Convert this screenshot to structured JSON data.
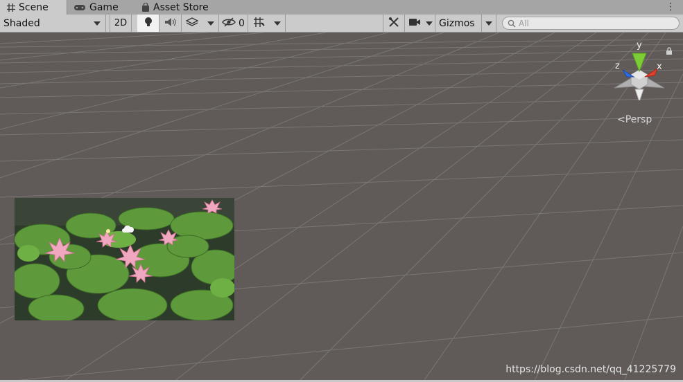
{
  "tabs": [
    {
      "label": "Scene",
      "icon": "hash-grid-icon",
      "active": true
    },
    {
      "label": "Game",
      "icon": "gamepad-icon",
      "active": false
    },
    {
      "label": "Asset Store",
      "icon": "shopping-bag-icon",
      "active": false
    }
  ],
  "toolbar": {
    "draw_mode": "Shaded",
    "mode_2d_label": "2D",
    "hidden_count": "0",
    "gizmos_label": "Gizmos",
    "search_placeholder": "All"
  },
  "viewport": {
    "background_color": "#605b58",
    "grid_color": "#7a7673",
    "projection_label": "Persp",
    "axis_labels": {
      "y": "y",
      "x": "x",
      "z": "z"
    },
    "axis_colors": {
      "y": "#7ccc36",
      "x": "#e0402c",
      "z": "#2f6ee8"
    },
    "image_description_name": "water-lily-quad"
  },
  "watermark": "https://blog.csdn.net/qq_41225779"
}
